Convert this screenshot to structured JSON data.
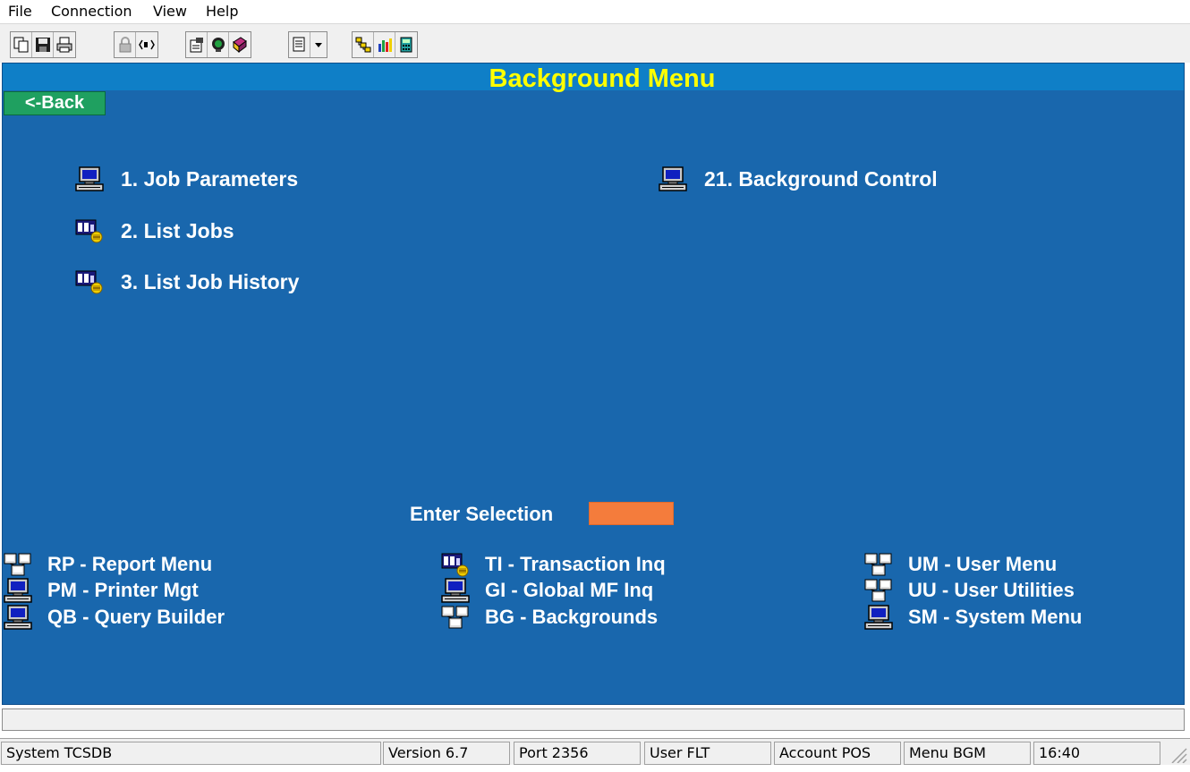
{
  "menubar": {
    "items": [
      "File",
      "Connection",
      "View",
      "Help"
    ]
  },
  "toolbar": {
    "icons": [
      "copy-icon",
      "save-icon",
      "print-icon",
      "lock-icon",
      "speaker-icon",
      "properties-icon",
      "monitor-icon",
      "book-icon",
      "document-icon",
      "dropdown-arrow-icon",
      "hierarchy-icon",
      "bar-chart-icon",
      "calculator-icon"
    ]
  },
  "screen": {
    "title": "Background Menu",
    "back_label": "<-Back",
    "items": [
      {
        "label": "1.  Job Parameters",
        "icon": "computer-icon"
      },
      {
        "label": "2.  List Jobs",
        "icon": "jobs-icon"
      },
      {
        "label": "3.  List Job History",
        "icon": "jobs-icon"
      },
      {
        "label": "21.  Background Control",
        "icon": "computer-icon"
      }
    ],
    "enter_selection_label": "Enter Selection",
    "enter_selection_value": "",
    "shortcuts": [
      {
        "label": "RP - Report Menu",
        "icon": "network-icon"
      },
      {
        "label": "PM - Printer Mgt",
        "icon": "computer-icon"
      },
      {
        "label": "QB - Query Builder",
        "icon": "computer-icon"
      },
      {
        "label": "TI - Transaction Inq",
        "icon": "jobs-icon"
      },
      {
        "label": "GI - Global MF Inq",
        "icon": "computer-icon"
      },
      {
        "label": "BG - Backgrounds",
        "icon": "network-icon"
      },
      {
        "label": "UM - User Menu",
        "icon": "network-icon"
      },
      {
        "label": "UU - User Utilities",
        "icon": "network-icon"
      },
      {
        "label": "SM - System Menu",
        "icon": "computer-icon"
      }
    ]
  },
  "message": "",
  "statusbar": {
    "system": "System TCSDB",
    "version": "Version 6.7",
    "port": "Port 2356",
    "user": "User FLT",
    "account": "Account POS",
    "menu": "Menu BGM",
    "time": "16:40"
  },
  "colors": {
    "screen_bg": "#1967ad",
    "title_bar": "#0f7fc7",
    "title_text": "#ffff00",
    "back_button": "#1fa060",
    "selection_input": "#f47c3c"
  }
}
